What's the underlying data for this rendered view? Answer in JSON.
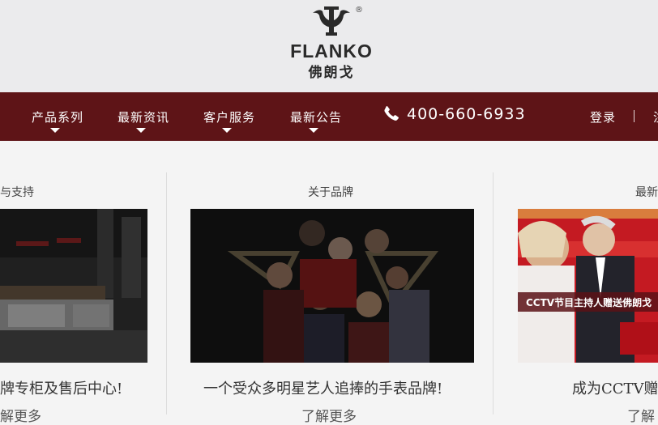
{
  "logo": {
    "registered": "®",
    "name_en": "FLANKO",
    "name_cn": "佛朗戈"
  },
  "nav": {
    "items": [
      {
        "label": "产品系列"
      },
      {
        "label": "最新资讯"
      },
      {
        "label": "客户服务"
      },
      {
        "label": "最新公告"
      }
    ],
    "phone": "400-660-6933",
    "login": "登录",
    "register": "注"
  },
  "columns": [
    {
      "title": "与支持",
      "image_alt": "store counter photo",
      "caption": "牌专柜及售后中心!",
      "more": "解更多"
    },
    {
      "title": "关于品牌",
      "image_alt": "celebrity group photo",
      "caption": "一个受众多明星艺人追捧的手表品牌!",
      "more": "了解更多"
    },
    {
      "title": "最新",
      "image_alt": "CCTV event photo",
      "image_banner": "CCTV节目主持人赠送佛朗戈",
      "caption": "成为CCTV赠送",
      "more": "了解"
    }
  ],
  "colors": {
    "nav_bg": "#5e1417",
    "header_bg": "#ebebed",
    "page_bg": "#f4f4f4"
  }
}
